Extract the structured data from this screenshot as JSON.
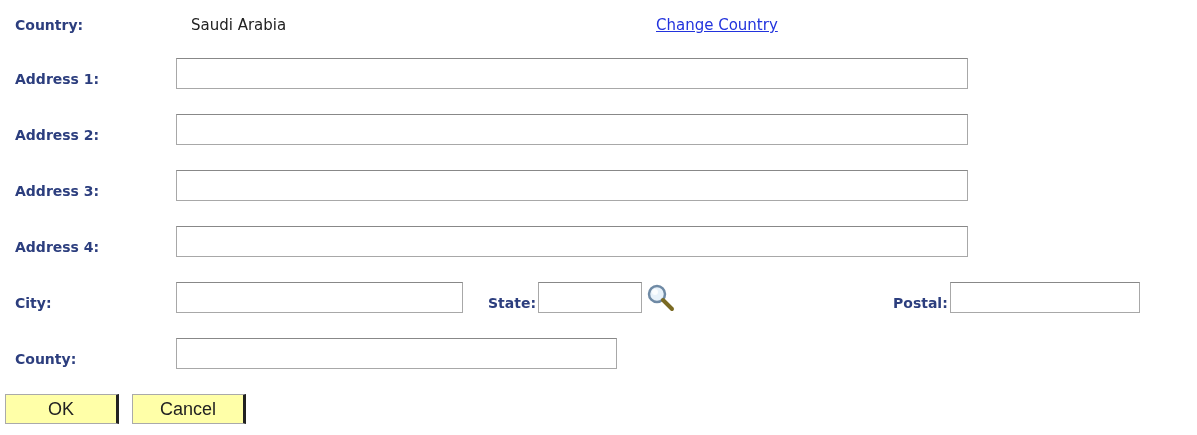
{
  "country": {
    "label": "Country:",
    "value": "Saudi Arabia",
    "link": "Change Country"
  },
  "address_lines": [
    {
      "label": "Address 1:"
    },
    {
      "label": "Address 2:"
    },
    {
      "label": "Address 3:"
    },
    {
      "label": "Address 4:"
    }
  ],
  "city": {
    "label": "City:"
  },
  "state": {
    "label": "State:"
  },
  "postal": {
    "label": "Postal:"
  },
  "county": {
    "label": "County:"
  },
  "buttons": [
    "OK",
    "Cancel"
  ]
}
